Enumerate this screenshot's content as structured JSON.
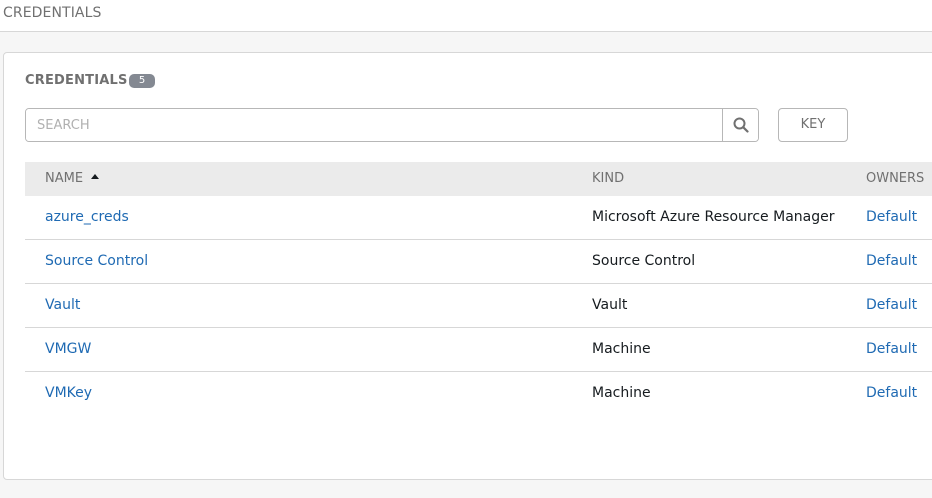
{
  "breadcrumb": {
    "label": "CREDENTIALS"
  },
  "panel": {
    "title": "CREDENTIALS",
    "count": "5"
  },
  "search": {
    "placeholder": "SEARCH",
    "value": "",
    "icon": "search-icon"
  },
  "key_button": {
    "label": "KEY"
  },
  "table": {
    "headers": {
      "name": "NAME",
      "kind": "KIND",
      "owners": "OWNERS"
    },
    "sort": {
      "column": "name",
      "direction": "ascending"
    },
    "rows": [
      {
        "name": "azure_creds",
        "kind": "Microsoft Azure Resource Manager",
        "owner": "Default"
      },
      {
        "name": "Source Control",
        "kind": "Source Control",
        "owner": "Default"
      },
      {
        "name": "Vault",
        "kind": "Vault",
        "owner": "Default"
      },
      {
        "name": "VMGW",
        "kind": "Machine",
        "owner": "Default"
      },
      {
        "name": "VMKey",
        "kind": "Machine",
        "owner": "Default"
      }
    ]
  },
  "colors": {
    "link": "#1f6ab3",
    "badge": "#848992",
    "header_bg": "#ebebeb"
  }
}
